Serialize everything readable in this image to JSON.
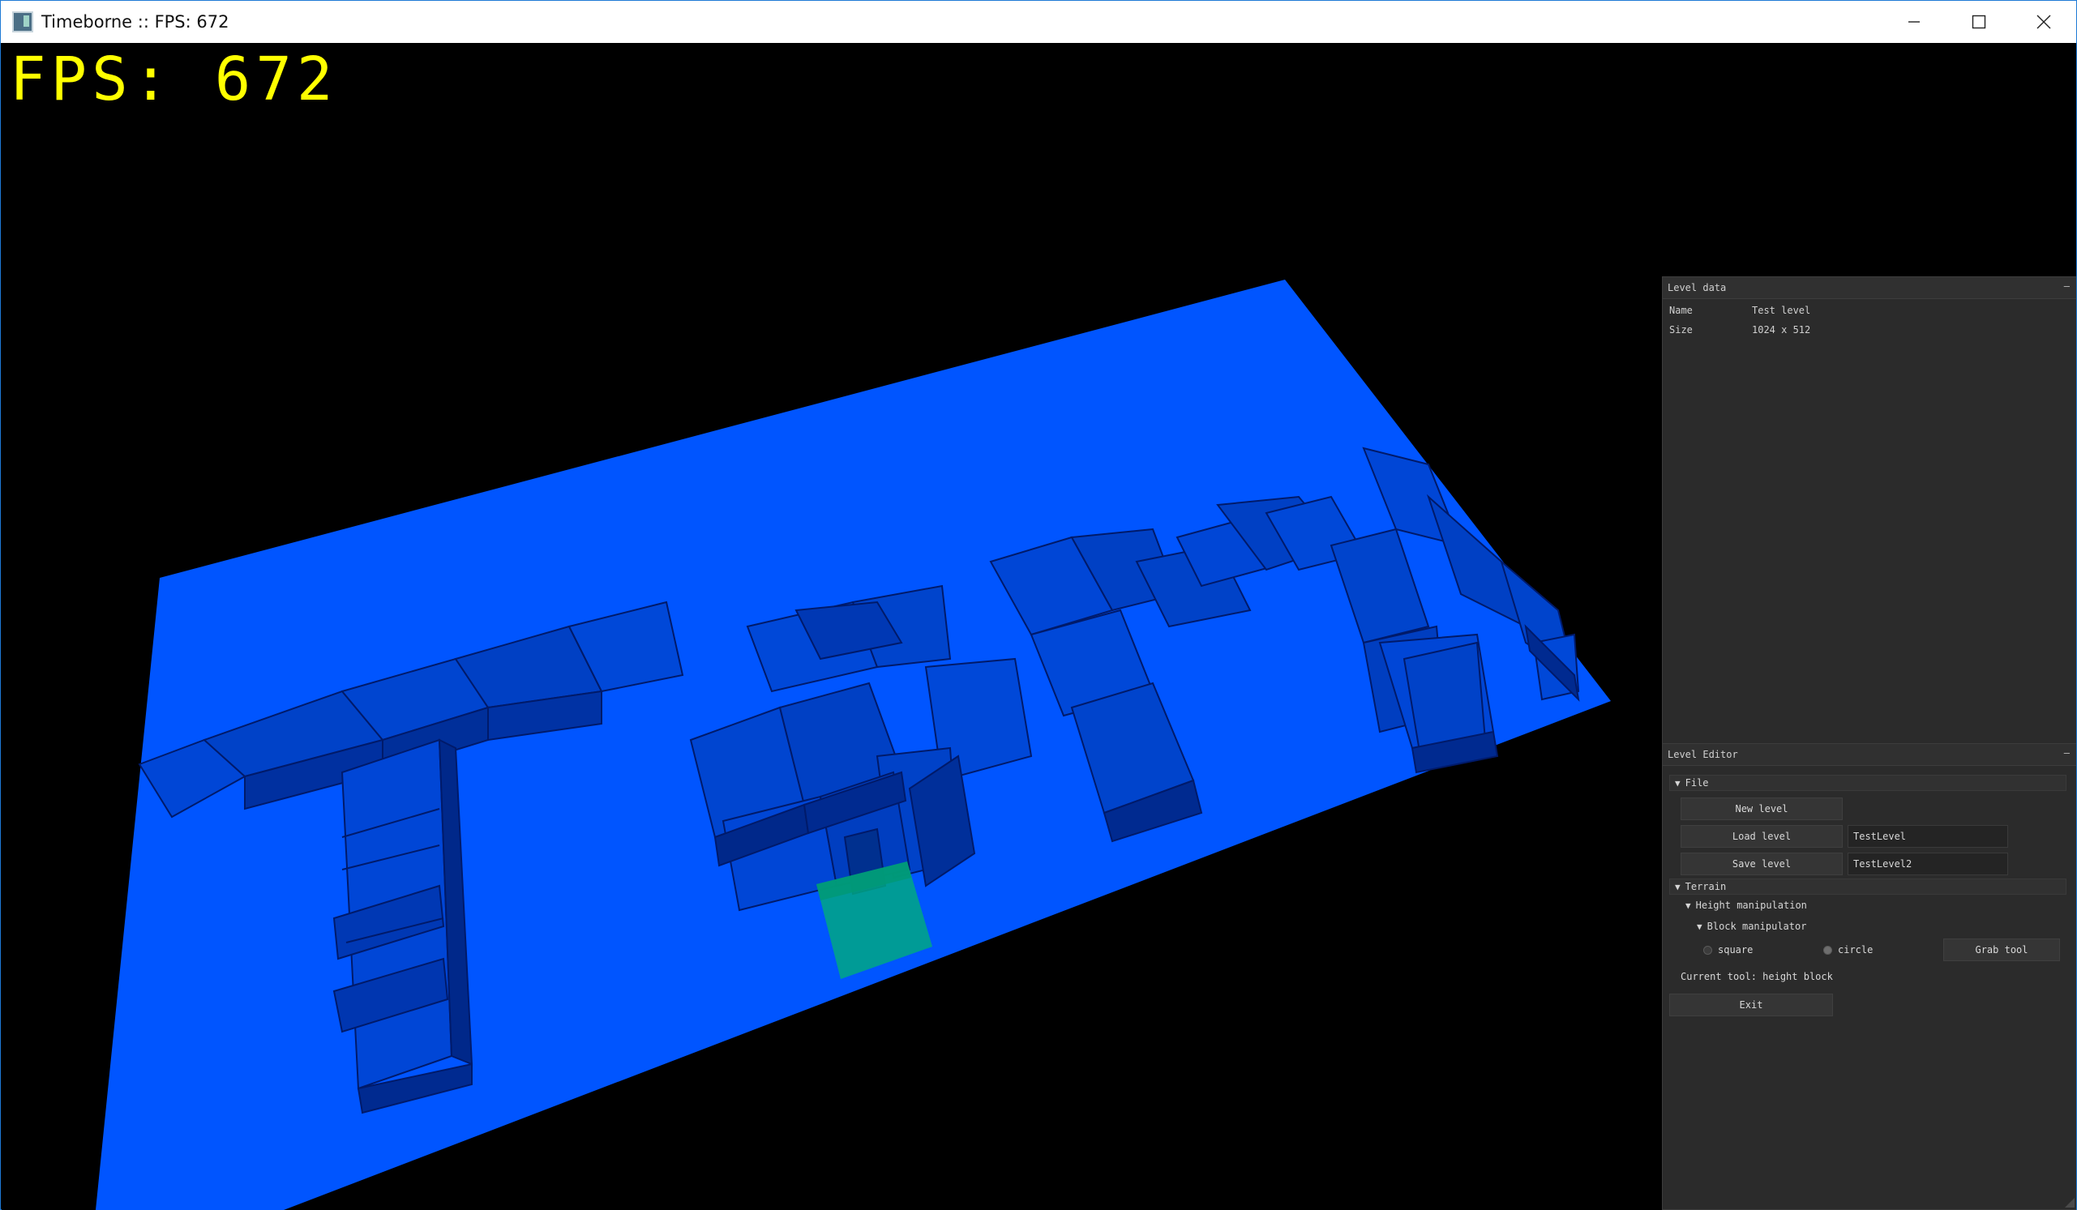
{
  "window": {
    "title": "Timeborne :: FPS: 672",
    "controls": {
      "minimize_icon": "minimize-icon",
      "maximize_icon": "maximize-icon",
      "close_icon": "close-icon"
    }
  },
  "viewport": {
    "fps_label": "FPS:",
    "fps_value": "672",
    "colors": {
      "terrain": "#0055ff",
      "selection": "#00a884",
      "fps_text": "#ffff00"
    }
  },
  "level_data_panel": {
    "title": "Level data",
    "collapse": "–",
    "rows": [
      {
        "key": "Name",
        "value": "Test level"
      },
      {
        "key": "Size",
        "value": "1024 x 512"
      }
    ]
  },
  "level_editor_panel": {
    "title": "Level Editor",
    "collapse": "–",
    "file_section": {
      "label": "File",
      "new_level": "New level",
      "load_level": "Load level",
      "load_input": "TestLevel",
      "save_level": "Save level",
      "save_input": "TestLevel2"
    },
    "terrain_section": {
      "label": "Terrain",
      "height_manipulation": "Height manipulation",
      "block_manipulator": "Block manipulator",
      "radio_square": "square",
      "radio_circle": "circle",
      "grab_tool": "Grab tool"
    },
    "current_tool": "Current tool: height block",
    "exit": "Exit"
  }
}
